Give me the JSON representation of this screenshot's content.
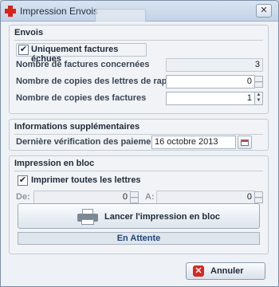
{
  "window": {
    "title": "Impression Envois",
    "close_glyph": "✕"
  },
  "envois": {
    "title": "Envois",
    "unpaid_only": {
      "label": "Uniquement factures échues",
      "checked": true,
      "glyph": "✔"
    },
    "count_label": "Nombre de factures concernées",
    "count_value": "3",
    "reminder_copies_label": "Nombre de copies des lettres de rappel",
    "reminder_copies_value": "0",
    "reminder_copies_minus": "—",
    "invoice_copies_label": "Nombre de copies des factures",
    "invoice_copies_value": "1",
    "spinner_up": "▲",
    "spinner_down": "▼"
  },
  "info": {
    "title": "Informations supplémentaires",
    "last_check_label": "Dernière vérification des paiements",
    "last_check_value": "16 octobre 2013",
    "calendar_icon": "calendar-icon"
  },
  "bulk": {
    "title": "Impression en bloc",
    "print_all": {
      "label": "Imprimer toutes les lettres",
      "checked": true,
      "glyph": "✔"
    },
    "from_label": "De:",
    "from_value": "0",
    "to_label": "A:",
    "to_value": "0",
    "minus_glyph": "—",
    "print_button_label": "Lancer l'impression en bloc",
    "printer_icon": "printer-icon",
    "status": "En Attente"
  },
  "footer": {
    "cancel_label": "Annuler",
    "cancel_glyph": "✕"
  },
  "colors": {
    "titlebar": "#c8d8ec",
    "status_text": "#20467a",
    "cancel_icon": "#d9261f",
    "app_icon": "#d8231c"
  }
}
